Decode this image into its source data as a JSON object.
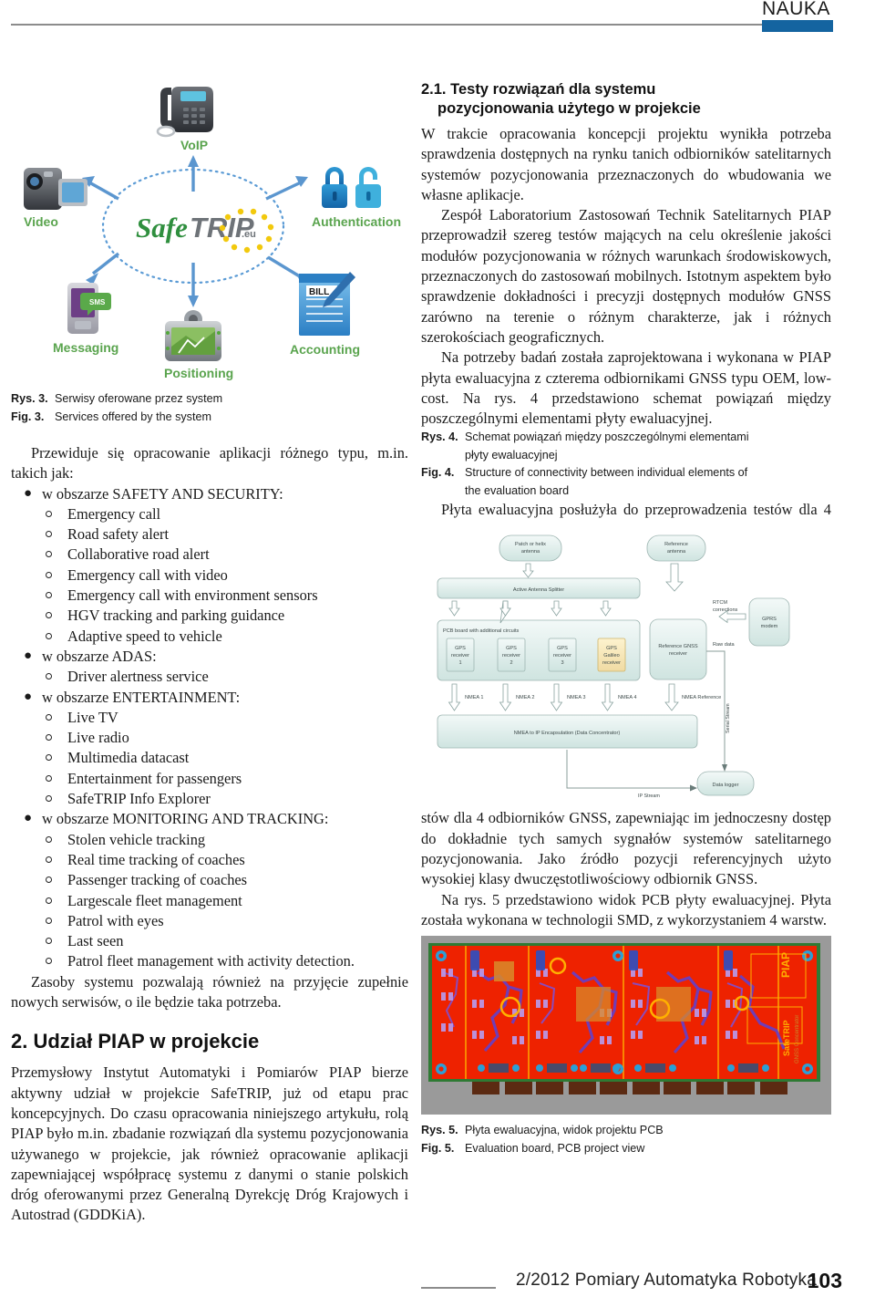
{
  "header": {
    "label": "NAUKA",
    "accent_color": "#1464a0",
    "rule_color": "#8c8c8c"
  },
  "figure3": {
    "center_logo": "SafeTRIP",
    "center_logo_suffix": ".eu",
    "nodes": [
      {
        "name": "voip",
        "label": "VoIP",
        "icon": "desk-phone-icon"
      },
      {
        "name": "authentication",
        "label": "Authentication",
        "icon": "padlock-icon"
      },
      {
        "name": "accounting",
        "label": "Accounting",
        "icon": "bill-notepad-icon"
      },
      {
        "name": "positioning",
        "label": "Positioning",
        "icon": "gps-navigator-icon"
      },
      {
        "name": "messaging",
        "label": "Messaging",
        "icon": "sms-phone-icon"
      },
      {
        "name": "video",
        "label": "Video",
        "icon": "camcorder-icon"
      }
    ],
    "caption_pl_label": "Rys. 3.",
    "caption_pl_text": "Serwisy oferowane przez system",
    "caption_en_label": "Fig. 3.",
    "caption_en_text": "Services offered by the system"
  },
  "left": {
    "intro": "Przewiduje się opracowanie aplikacji różnego typu, m.in. takich jak:",
    "groups": [
      {
        "title": "w obszarze SAFETY AND SECURITY:",
        "items": [
          "Emergency call",
          "Road safety alert",
          "Collaborative road alert",
          "Emergency call with video",
          "Emergency call with environment sensors",
          "HGV tracking and parking guidance",
          "Adaptive speed to vehicle"
        ]
      },
      {
        "title": "w obszarze ADAS:",
        "items": [
          "Driver alertness service"
        ]
      },
      {
        "title": "w obszarze ENTERTAINMENT:",
        "items": [
          "Live TV",
          "Live radio",
          "Multimedia datacast",
          "Entertainment for passengers",
          "SafeTRIP Info Explorer"
        ]
      },
      {
        "title": "w obszarze MONITORING AND TRACKING:",
        "items": [
          "Stolen vehicle tracking",
          "Real time tracking of coaches",
          "Passenger tracking of coaches",
          "Largescale fleet management",
          "Patrol with eyes",
          "Last seen",
          "Patrol fleet management with activity detection."
        ]
      }
    ],
    "after_list": "Zasoby systemu pozwalają również na przyjęcie zupełnie nowych serwisów, o ile będzie taka potrzeba.",
    "section_heading": "2. Udział PIAP w projekcie",
    "section_paragraph": "Przemysłowy Instytut Automatyki i Pomiarów PIAP bierze aktywny udział w projekcie SafeTRIP, już od etapu prac koncepcyjnych. Do czasu opracowania niniejszego artykułu, rolą PIAP było m.in. zbadanie rozwiązań dla systemu pozycjonowania używanego w projekcie, jak również opracowanie aplikacji zapewniającej współpracę systemu z danymi o stanie polskich dróg oferowanymi przez Generalną Dyrekcję Dróg Krajowych i Autostrad (GDDKiA)."
  },
  "right": {
    "subsection_heading_line1": "2.1. Testy rozwiązań dla systemu",
    "subsection_heading_line2": "pozycjonowania użytego w projekcie",
    "para1": "W trakcie opracowania koncepcji projektu wynikła potrzeba sprawdzenia dostępnych na rynku tanich odbiorników satelitarnych systemów pozycjonowania przeznaczonych do wbudowania we własne aplikacje.",
    "para2": "Zespół Laboratorium Zastosowań Technik Satelitarnych PIAP przeprowadził szereg testów mających na celu określenie jakości modułów pozycjonowania w różnych warunkach środowiskowych, przeznaczonych do zastosowań mobilnych. Istotnym aspektem było sprawdzenie dokładności i precyzji dostępnych modułów GNSS zarówno na terenie o różnym charakterze, jak i różnych szerokościach geograficznych.",
    "para3": "Na potrzeby badań została zaprojektowana i wykonana w PIAP płyta ewaluacyjna z czterema odbiornikami GNSS typu OEM, low-cost. Na rys. 4 przedstawiono schemat powiązań między poszczególnymi elementami płyty ewaluacyjnej.",
    "para4": "Płyta ewaluacyjna posłużyła do przeprowadzenia testów dla 4 odbiorników GNSS, zapewniając im jednoczesny dostęp do dokładnie tych samych sygnałów systemów satelitarnego pozycjonowania. Jako źródło pozycji referencyjnych użyto wysokiej klasy dwuczęstotliwościowy odbiornik GNSS.",
    "para5": "Na rys. 5 przedstawiono widok PCB płyty ewaluacyjnej. Płyta została wykonana w technologii SMD, z wykorzystaniem 4 warstw.",
    "fig4_caption_pl_label": "Rys. 4.",
    "fig4_caption_pl_text": "Schemat powiązań między poszczególnymi elementami",
    "fig4_caption_pl_text2": "płyty ewaluacyjnej",
    "fig4_caption_en_label": "Fig. 4.",
    "fig4_caption_en_text": "Structure of connectivity between individual elements of",
    "fig4_caption_en_text2": "the evaluation board",
    "fig5_caption_pl_label": "Rys. 5.",
    "fig5_caption_pl_text": "Płyta ewaluacyjna, widok projektu PCB",
    "fig5_caption_en_label": "Fig. 5.",
    "fig5_caption_en_text": "Evaluation board, PCB project view"
  },
  "figure4": {
    "blocks": [
      {
        "name": "patch-antenna",
        "label_line1": "Patch or helix",
        "label_line2": "antenna"
      },
      {
        "name": "reference-antenna",
        "label_line1": "Reference",
        "label_line2": "antenna"
      },
      {
        "name": "active-antenna-splitter",
        "label_line1": "Active Antenna Splitter"
      },
      {
        "name": "pcb-board",
        "label_line1": "PCB board with additional circuits"
      },
      {
        "name": "gps-receiver-1",
        "label_line1": "GPS",
        "label_line2": "receiver",
        "label_line3": "1"
      },
      {
        "name": "gps-receiver-2",
        "label_line1": "GPS",
        "label_line2": "receiver",
        "label_line3": "2"
      },
      {
        "name": "gps-receiver-3",
        "label_line1": "GPS",
        "label_line2": "receiver",
        "label_line3": "3"
      },
      {
        "name": "gps-galileo-receiver",
        "label_line1": "GPS",
        "label_line2": "Galileo",
        "label_line3": "receiver"
      },
      {
        "name": "reference-gnss-receiver",
        "label_line1": "Reference GNSS",
        "label_line2": "receiver"
      },
      {
        "name": "gprs-modem",
        "label_line1": "GPRS",
        "label_line2": "modem"
      },
      {
        "name": "nmea-encapsulation",
        "label_line1": "NMEA to IP Encapsulation (Data Concentrator)"
      },
      {
        "name": "data-logger",
        "label_line1": "Data logger"
      }
    ],
    "edge_labels": [
      "NMEA 1",
      "NMEA 2",
      "NMEA 3",
      "NMEA 4",
      "NMEA Reference",
      "RTCM corrections",
      "Raw data",
      "Serial Stream",
      "IP Stream"
    ],
    "highlight_color": "#f5e6b8",
    "block_color": "#dfeeea"
  },
  "figure5": {
    "board_text_1": "SafeTRIP",
    "board_text_2": "GNSS Concentrator",
    "board_text_3": "PIAP"
  },
  "footer": {
    "journal": "2/2012 Pomiary Automatyka Robotyka",
    "page": "103"
  }
}
